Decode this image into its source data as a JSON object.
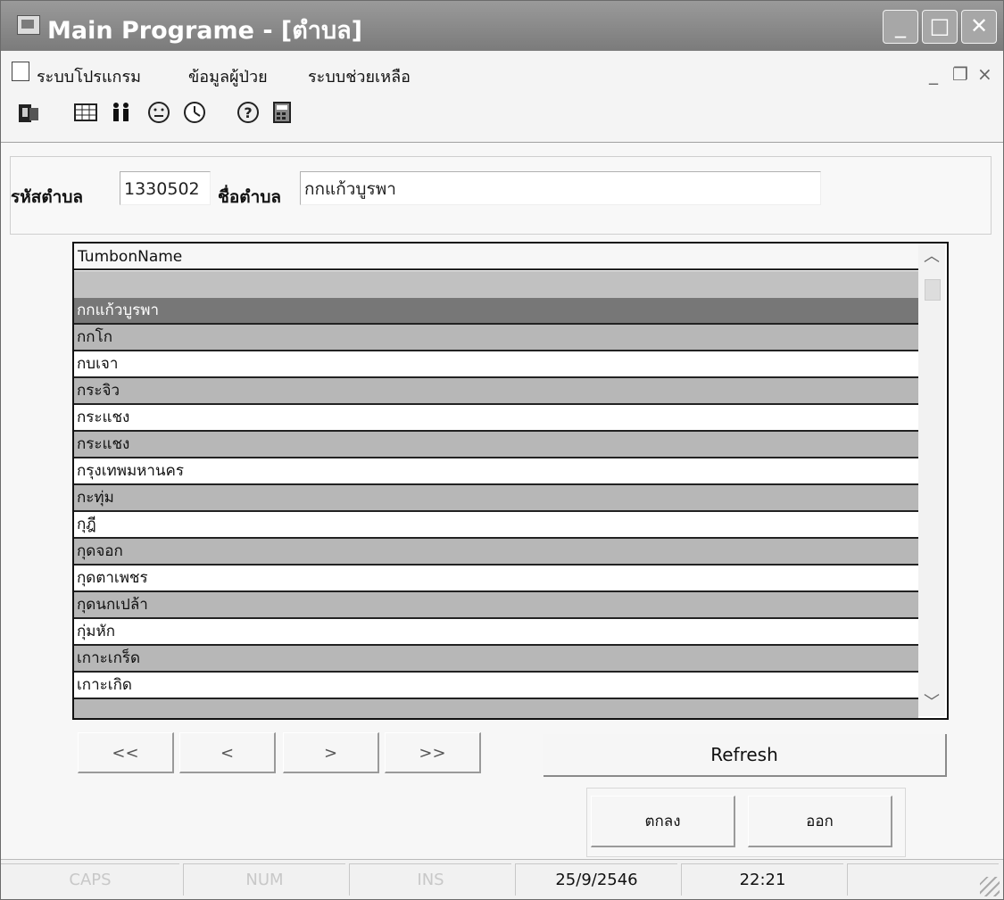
{
  "window": {
    "title": "Main Programe - [ตำบล]",
    "controls": {
      "minimize": "_",
      "maximize": "□",
      "close": "✕"
    }
  },
  "menubar": {
    "items": [
      "ระบบโปรแกรม",
      "ข้อมูลผู้ป่วย",
      "ระบบช่วยเหลือ"
    ],
    "mdi_minimize": "_",
    "mdi_restore": "❐",
    "mdi_close": "×"
  },
  "toolbar": {
    "icons": [
      "exit-icon",
      "table-icon",
      "people-icon",
      "face-icon",
      "clock-icon",
      "help-icon",
      "calculator-icon"
    ]
  },
  "form": {
    "code_label": "รหัสตำบล",
    "code_value": "1330502",
    "name_label": "ชื่อตำบล",
    "name_value": "กกแก้วบูรพา"
  },
  "grid": {
    "column_header": "TumbonName",
    "rows": [
      "",
      "กกแก้วบูรพา",
      "กกโก",
      "กบเจา",
      "กระจิว",
      "กระแชง",
      "กระแชง",
      "กรุงเทพมหานคร",
      "กะทุ่ม",
      "กุฎี",
      "กุดจอก",
      "กุดตาเพชร",
      "กุดนกเปล้า",
      "กุ่มหัก",
      "เกาะเกร็ด",
      "เกาะเกิด",
      ""
    ],
    "selected_index": 1
  },
  "navigation": {
    "first": "<<",
    "prev": "<",
    "next": ">",
    "last": ">>",
    "refresh": "Refresh"
  },
  "actions": {
    "ok": "ตกลง",
    "exit": "ออก"
  },
  "status": {
    "caps": "CAPS",
    "num": "NUM",
    "ins": "INS",
    "date": "25/9/2546",
    "time": "22:21"
  }
}
